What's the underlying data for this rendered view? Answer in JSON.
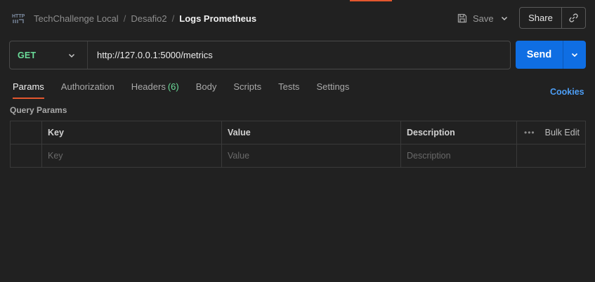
{
  "header": {
    "breadcrumb": {
      "workspace": "TechChallenge Local",
      "collection": "Desafio2",
      "request": "Logs Prometheus"
    },
    "save_label": "Save",
    "share_label": "Share"
  },
  "request": {
    "method": "GET",
    "url": "http://127.0.0.1:5000/metrics",
    "send_label": "Send"
  },
  "tabs": [
    {
      "label": "Params",
      "active": true
    },
    {
      "label": "Authorization"
    },
    {
      "label": "Headers",
      "count": "(6)"
    },
    {
      "label": "Body"
    },
    {
      "label": "Scripts"
    },
    {
      "label": "Tests"
    },
    {
      "label": "Settings"
    }
  ],
  "cookies_label": "Cookies",
  "query_params": {
    "title": "Query Params",
    "columns": {
      "key": "Key",
      "value": "Value",
      "description": "Description",
      "bulk_edit": "Bulk Edit"
    },
    "placeholders": {
      "key": "Key",
      "value": "Value",
      "description": "Description"
    }
  },
  "colors": {
    "accent": "#e4572e",
    "method_get": "#6bdd9a",
    "send": "#0f6ee3",
    "link": "#4d9ff7"
  }
}
